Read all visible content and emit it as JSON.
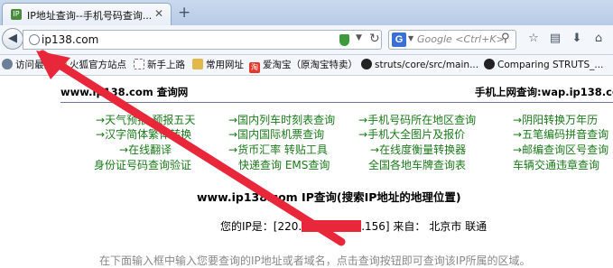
{
  "browser": {
    "tab_title": "IP地址查询--手机号码查询...",
    "tab_favicon": "IP",
    "new_tab_label": "+",
    "url": "ip138.com",
    "search_placeholder": "Google <Ctrl+K>",
    "search_engine_letter": "G"
  },
  "bookmarks": [
    {
      "label": "访问最多",
      "icon": "gear-icon",
      "color": "#6b7f99"
    },
    {
      "label": "火狐官方站点",
      "icon": "folder-icon",
      "color": "#e3b84a"
    },
    {
      "label": "新手上路",
      "icon": "page-icon",
      "color": "#ffffff"
    },
    {
      "label": "常用网址",
      "icon": "folder-icon",
      "color": "#e3b84a"
    },
    {
      "label": "爱淘宝（原淘宝特卖）",
      "icon": "taobao-icon",
      "color": "#e0382b",
      "icon_text": "淘"
    },
    {
      "label": "struts/core/src/main...",
      "icon": "github-icon",
      "color": "#222222"
    },
    {
      "label": "Comparing STRUTS_...",
      "icon": "github-icon",
      "color": "#222222"
    }
  ],
  "site": {
    "left_header": "www.ip138.com 查询网",
    "right_header": "手机上网查询:wap.ip138.com"
  },
  "links": {
    "col1": [
      "天气预报-预报五天",
      "汉字简体繁体转换",
      "在线翻译",
      "身份证号码查询验证"
    ],
    "col2": [
      "国内列车时刻表查询",
      "国内国际机票查询",
      "货币汇率 转贴工具",
      "快递查询 EMS查询"
    ],
    "col3": [
      "手机号码所在地区查询",
      "手机大全图片及报价",
      "在线度衡量转换器",
      "全国各地车牌查询表"
    ],
    "col4": [
      "阴阳转换万年历",
      "五笔编码拼音查询",
      "邮编查询区号查询",
      "车辆交通违章查询"
    ]
  },
  "link_arrow": "→",
  "main": {
    "title": "www.ip138.com IP查询(搜索IP地址的地理位置)",
    "ip_label": "您的IP是：",
    "ip_prefix": "[220.",
    "ip_suffix": ".156]",
    "from_label": "来自：",
    "location": "北京市 联通",
    "bottom_text": "在下面输入框中输入您要查询的IP地址或者域名，点击查询按钮即可查询该IP所属的区域。"
  },
  "colors": {
    "link": "#1a7a1a",
    "annotation_arrow": "#e8283a",
    "redaction": "#e8283a"
  }
}
